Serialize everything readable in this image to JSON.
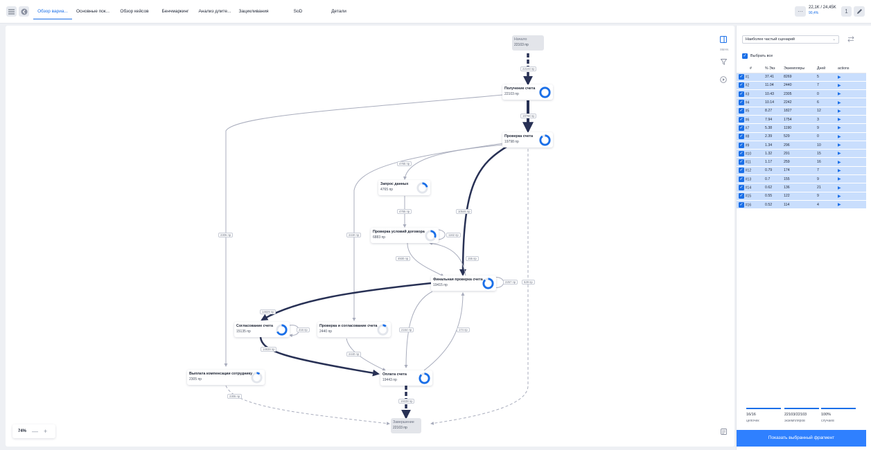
{
  "tabs": [
    {
      "label": "Обзор вариа...",
      "active": true
    },
    {
      "label": "Основные пок...",
      "active": false
    },
    {
      "label": "Обзор кейсов",
      "active": false
    },
    {
      "label": "Бенчмаркинг",
      "active": false
    },
    {
      "label": "Анализ длите...",
      "active": false
    },
    {
      "label": "Зацикливания",
      "active": false
    },
    {
      "label": "SoD",
      "active": false
    },
    {
      "label": "Детали",
      "active": false
    }
  ],
  "header": {
    "counter_value": "22,1K / 24,45K",
    "counter_percent": "90,4%",
    "more_label": "···",
    "one_label": "1"
  },
  "nodes": {
    "start": {
      "title": "Начало",
      "count": "22103 пр"
    },
    "receive": {
      "title": "Получение счета",
      "count": "22103 пр",
      "fill": 1.0
    },
    "check": {
      "title": "Проверка счета",
      "count": "19798 пр",
      "fill": 0.9
    },
    "request": {
      "title": "Запрос данных",
      "count": "4765 пр",
      "fill": 0.22
    },
    "contract": {
      "title": "Проверка условий договора",
      "count": "6883 пр",
      "fill": 0.31
    },
    "final": {
      "title": "Финальная проверка счета",
      "count": "19415 пр",
      "fill": 0.88
    },
    "agree": {
      "title": "Согласование счета",
      "count": "15135 пр",
      "fill": 0.68
    },
    "checkagree": {
      "title": "Проверка и согласование счета",
      "count": "2440 пр",
      "fill": 0.11
    },
    "pay": {
      "title": "Оплата счета",
      "count": "19443 пр",
      "fill": 0.88
    },
    "comp": {
      "title": "Выплата компенсации сотруднику",
      "count": "2305 пр",
      "fill": 0.1
    },
    "end": {
      "title": "Завершение",
      "count": "22103 пр"
    }
  },
  "edge_labels": {
    "start_receive": "22103 пр",
    "receive_check": "19798 пр",
    "check_request": "4765 пр",
    "request_contract": "4765 пр",
    "contract_self": "1162 пр",
    "check_final": "10546 пр",
    "contract_final": "4930 пр",
    "final_contract": "155 пр",
    "final_self": "2257 пр",
    "check_end": "529 пр",
    "receive_comp": "2305 пр",
    "check_checkagree": "2440 пр",
    "final_agree": "14829 пр",
    "agree_self": "216 пр",
    "agree_pay": "14839 пр",
    "final_pay": "2164 пр",
    "pay_final": "174 пр",
    "checkagree_pay": "2440 пр",
    "pay_end": "19338 пр",
    "comp_end": "2305 пр"
  },
  "canvas": {
    "zoom": "74%",
    "minus": "—",
    "plus": "+",
    "icon_caption": "SMAN"
  },
  "panel": {
    "scenario_select": "Наиболее частый сценарий",
    "select_all": "Выбрать все",
    "columns": [
      "#",
      "% Экз",
      "Экземпляры",
      "Дней",
      "actions"
    ],
    "rows": [
      {
        "id": "#1",
        "pct": "37.41",
        "inst": "8269",
        "days": "5"
      },
      {
        "id": "#2",
        "pct": "11.04",
        "inst": "2440",
        "days": "7"
      },
      {
        "id": "#3",
        "pct": "10.43",
        "inst": "2305",
        "days": "0"
      },
      {
        "id": "#4",
        "pct": "10.14",
        "inst": "2242",
        "days": "6"
      },
      {
        "id": "#5",
        "pct": "8.27",
        "inst": "1827",
        "days": "12"
      },
      {
        "id": "#6",
        "pct": "7.94",
        "inst": "1754",
        "days": "3"
      },
      {
        "id": "#7",
        "pct": "5.38",
        "inst": "1190",
        "days": "9"
      },
      {
        "id": "#8",
        "pct": "2.39",
        "inst": "529",
        "days": "0"
      },
      {
        "id": "#9",
        "pct": "1.34",
        "inst": "296",
        "days": "10"
      },
      {
        "id": "#10",
        "pct": "1.32",
        "inst": "291",
        "days": "15"
      },
      {
        "id": "#11",
        "pct": "1.17",
        "inst": "259",
        "days": "16"
      },
      {
        "id": "#12",
        "pct": "0.79",
        "inst": "174",
        "days": "7"
      },
      {
        "id": "#13",
        "pct": "0.7",
        "inst": "155",
        "days": "9"
      },
      {
        "id": "#14",
        "pct": "0.62",
        "inst": "136",
        "days": "21"
      },
      {
        "id": "#15",
        "pct": "0.55",
        "inst": "122",
        "days": "9"
      },
      {
        "id": "#16",
        "pct": "0.52",
        "inst": "114",
        "days": "4"
      }
    ],
    "stats": [
      {
        "value": "16/16",
        "label": "цепочек"
      },
      {
        "value": "22103/22103",
        "label": "экземпляров"
      },
      {
        "value": "100%",
        "label": "случаев"
      }
    ],
    "show_button": "Показать выбранный фрагмент"
  },
  "colors": {
    "accent": "#1a6fe8",
    "edge_dark": "#283155",
    "edge_light": "#a9adbd",
    "row_selected": "#c9defd",
    "button": "#2f80ff"
  }
}
